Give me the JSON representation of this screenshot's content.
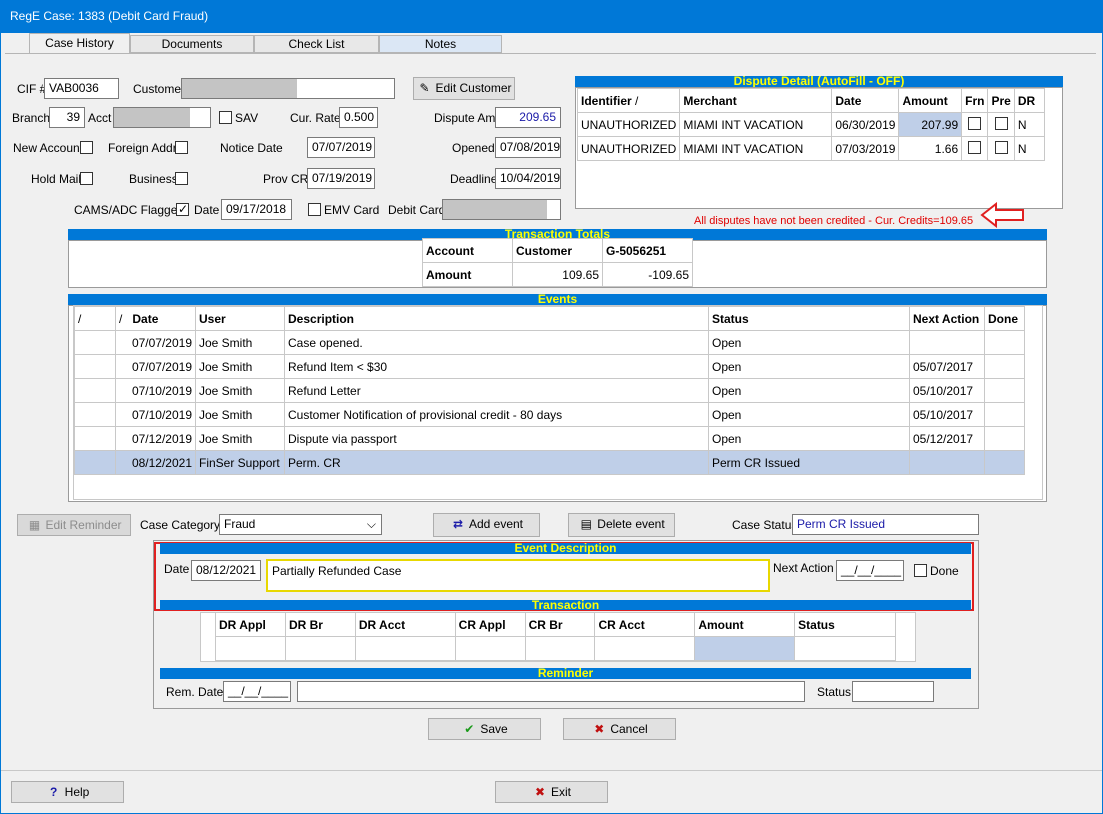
{
  "window": {
    "title": "RegE Case: 1383 (Debit Card Fraud)"
  },
  "tabs": [
    {
      "label": "Case History"
    },
    {
      "label": "Documents"
    },
    {
      "label": "Check List"
    },
    {
      "label": "Notes"
    }
  ],
  "case_fields": {
    "cif_label": "CIF #",
    "cif_value": "VAB0036",
    "customer_label": "Customer",
    "edit_customer_label": "Edit Customer",
    "branch_label": "Branch",
    "branch_value": "39",
    "acct_label": "Acct",
    "sav_label": "SAV",
    "cur_rate_label": "Cur. Rate",
    "cur_rate_value": "0.500",
    "dispute_amt_label": "Dispute Amt",
    "dispute_amt_value": "209.65",
    "new_account_label": "New Account",
    "foreign_addr_label": "Foreign Addr",
    "notice_date_label": "Notice Date",
    "notice_date_value": "07/07/2019",
    "opened_label": "Opened",
    "opened_value": "07/08/2019",
    "hold_mail_label": "Hold Mail",
    "business_label": "Business",
    "prov_cr_label": "Prov CR",
    "prov_cr_value": "07/19/2019",
    "deadline_label": "Deadline",
    "deadline_value": "10/04/2019",
    "cams_label": "CAMS/ADC Flagged",
    "date_label": "Date",
    "cams_date_value": "09/17/2018",
    "emv_label": "EMV Card",
    "debit_card_label": "Debit Card"
  },
  "dispute_detail": {
    "title": "Dispute Detail (AutoFill - OFF)",
    "columns": [
      "Identifier",
      "Merchant",
      "Date",
      "Amount",
      "Frn",
      "Pre",
      "DR"
    ],
    "rows": [
      {
        "identifier": "UNAUTHORIZED",
        "merchant": "MIAMI INT VACATION",
        "date": "06/30/2019",
        "amount": "207.99",
        "dr": "N"
      },
      {
        "identifier": "UNAUTHORIZED",
        "merchant": "MIAMI INT VACATION",
        "date": "07/03/2019",
        "amount": "1.66",
        "dr": "N"
      }
    ],
    "warning": "All disputes have not been credited - Cur. Credits=109.65"
  },
  "transaction_totals": {
    "title": "Transaction Totals",
    "headers": [
      "Account",
      "Customer",
      "G-5056251"
    ],
    "row_label": "Amount",
    "values": [
      "109.65",
      "-109.65"
    ]
  },
  "events": {
    "title": "Events",
    "columns": [
      "/",
      "/",
      "Date",
      "User",
      "Description",
      "Status",
      "Next Action",
      "Done"
    ],
    "rows": [
      {
        "date": "07/07/2019",
        "user": "Joe Smith",
        "description": "Case opened.",
        "status": "Open",
        "next_action": ""
      },
      {
        "date": "07/07/2019",
        "user": "Joe Smith",
        "description": "Refund Item < $30",
        "status": "Open",
        "next_action": "05/07/2017"
      },
      {
        "date": "07/10/2019",
        "user": "Joe Smith",
        "description": "Refund Letter",
        "status": "Open",
        "next_action": "05/10/2017"
      },
      {
        "date": "07/10/2019",
        "user": "Joe Smith",
        "description": "Customer Notification of provisional credit - 80 days",
        "status": "Open",
        "next_action": "05/10/2017"
      },
      {
        "date": "07/12/2019",
        "user": "Joe Smith",
        "description": "Dispute via passport",
        "status": "Open",
        "next_action": "05/12/2017"
      },
      {
        "date": "08/12/2021",
        "user": "FinSer Support",
        "description": "Perm. CR",
        "status": "Perm CR Issued",
        "next_action": ""
      }
    ]
  },
  "actions_row": {
    "edit_reminder_label": "Edit Reminder",
    "case_category_label": "Case Category",
    "case_category_value": "Fraud",
    "add_event_label": "Add event",
    "delete_event_label": "Delete event",
    "case_status_label": "Case Status",
    "case_status_value": "Perm CR Issued"
  },
  "event_description": {
    "title": "Event Description",
    "date_label": "Date",
    "date_value": "08/12/2021",
    "text_value": "Partially Refunded Case",
    "next_action_label": "Next Action",
    "next_action_value": "__/__/____",
    "done_label": "Done"
  },
  "transaction": {
    "title": "Transaction",
    "columns": [
      "DR Appl",
      "DR Br",
      "DR Acct",
      "CR Appl",
      "CR Br",
      "CR Acct",
      "Amount",
      "Status"
    ]
  },
  "reminder": {
    "title": "Reminder",
    "rem_date_label": "Rem. Date",
    "rem_date_value": "__/__/____",
    "status_label": "Status"
  },
  "buttons": {
    "save": "Save",
    "cancel": "Cancel",
    "help": "Help",
    "exit": "Exit"
  },
  "colors": {
    "titlebar": "#0078d7",
    "section_header": "#0078d7",
    "section_text": "#ffff00",
    "warning": "#e00000",
    "highlight": "#e02020"
  }
}
